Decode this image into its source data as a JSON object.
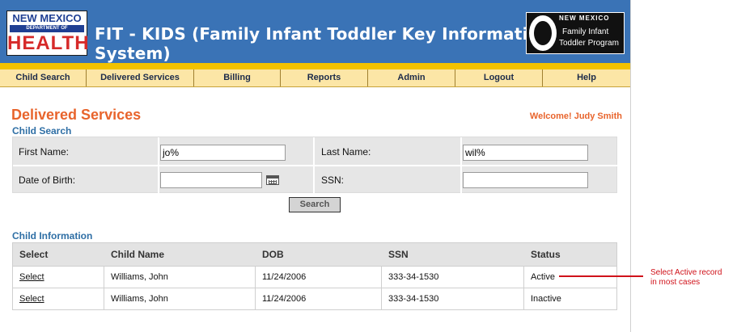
{
  "header": {
    "logo_nm": {
      "line1": "NEW MEXICO",
      "line2": "DEPARTMENT OF",
      "line3": "HEALTH"
    },
    "app_title": "FIT - KIDS (Family Infant Toddler Key Information Data System)",
    "logo_fit": {
      "line1": "NEW MEXICO",
      "line2": "Family Infant",
      "line3": "Toddler Program"
    },
    "colors": {
      "banner": "#3a73b6",
      "gold": "#f2c200",
      "nav": "#fce6a6"
    }
  },
  "nav": {
    "items": [
      {
        "label": "Child Search"
      },
      {
        "label": "Delivered Services"
      },
      {
        "label": "Billing"
      },
      {
        "label": "Reports"
      },
      {
        "label": "Admin"
      },
      {
        "label": "Logout"
      },
      {
        "label": "Help"
      }
    ]
  },
  "page": {
    "title": "Delivered Services",
    "welcome": "Welcome! Judy Smith"
  },
  "child_search": {
    "section_title": "Child Search",
    "first_name_label": "First Name:",
    "first_name_value": "jo%",
    "last_name_label": "Last Name:",
    "last_name_value": "wil%",
    "dob_label": "Date of Birth:",
    "dob_value": "",
    "ssn_label": "SSN:",
    "ssn_value": "",
    "calendar_icon": "calendar-icon",
    "search_button": "Search"
  },
  "child_information": {
    "section_title": "Child Information",
    "columns": [
      "Select",
      "Child Name",
      "DOB",
      "SSN",
      "Status"
    ],
    "rows": [
      {
        "select": "Select",
        "name": "Williams, John",
        "dob": "11/24/2006",
        "ssn": "333-34-1530",
        "status": "Active"
      },
      {
        "select": "Select",
        "name": "Williams, John",
        "dob": "11/24/2006",
        "ssn": "333-34-1530",
        "status": "Inactive"
      }
    ]
  },
  "annotation": {
    "line1": "Select Active record",
    "line2": "in most cases",
    "color": "#d0121a"
  }
}
